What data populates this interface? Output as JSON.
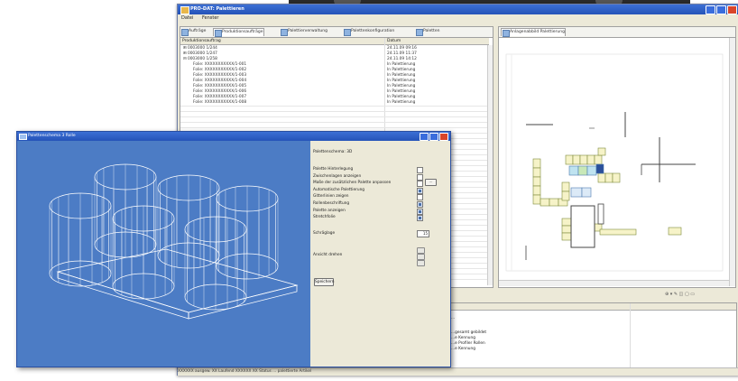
{
  "main_window": {
    "title": "PRO-DAT: Palettieren",
    "menu": [
      "Datei",
      "Fenster"
    ],
    "left_tabs": [
      "Aufträge",
      "Produktionsaufträge",
      "Palettierverwaltung",
      "Palettenkonfiguration",
      "Paletten"
    ],
    "right_tab": "Anlagenabbild Palettierung",
    "left_table": {
      "headers": [
        "Produktionsauftrag",
        "Datum"
      ],
      "rows": [
        {
          "c1": "⊞ 0003000 1/244",
          "c2": "24.11.09 09:16"
        },
        {
          "c1": "⊞ 0003000 1/247",
          "c2": "24.11.09 11:37"
        },
        {
          "c1": "⊟ 0003000 1/258",
          "c2": "24.11.09 14:12"
        },
        {
          "c1": "Folie: XXXXXXXXXXX/1-001",
          "c2": "In Palettierung"
        },
        {
          "c1": "Folie: XXXXXXXXXXX/1-002",
          "c2": "In Palettierung"
        },
        {
          "c1": "Folie: XXXXXXXXXXX/1-003",
          "c2": "In Palettierung"
        },
        {
          "c1": "Folie: XXXXXXXXXXX/1-004",
          "c2": "In Palettierung"
        },
        {
          "c1": "Folie: XXXXXXXXXXX/1-005",
          "c2": "In Palettierung"
        },
        {
          "c1": "Folie: XXXXXXXXXXX/1-006",
          "c2": "In Palettierung"
        },
        {
          "c1": "Folie: XXXXXXXXXXX/1-007",
          "c2": "In Palettierung"
        },
        {
          "c1": "Folie: XXXXXXXXXXX/1-008",
          "c2": "In Palettierung"
        }
      ]
    },
    "lower_panel": {
      "lines": [
        "...",
        "...gesamt gebildet",
        "...e Kennung",
        "...e Profiler Rollen",
        "...e Kennung"
      ]
    },
    "status_bar": "XXXXXX   ausgew.     XX     Laufend     XXXXXX     XX  Status     ...  palettierte Artikel"
  },
  "dialog": {
    "title": "Palettenschema 3 Rolle",
    "section_title": "Palettenschema: 3D",
    "options": [
      {
        "label": "Palette Hinterlegung",
        "checked": false
      },
      {
        "label": "Zwischenlagen anzeigen",
        "checked": false
      },
      {
        "label": "Maße der zusätzlichen Palette anpassen",
        "checked": false
      },
      {
        "label": "Automatische Palettierung",
        "checked": true
      },
      {
        "label": "Gitterlinien zeigen",
        "checked": false
      },
      {
        "label": "Rollenbeschriftung",
        "checked": true
      },
      {
        "label": "Palette anzeigen",
        "checked": true
      },
      {
        "label": "Stretchfolie",
        "checked": true
      }
    ],
    "browse_label": "...",
    "spin_label": "Schräglage",
    "spin_value": "15",
    "view_label": "Ansicht drehen",
    "apply_label": "Speichern"
  }
}
